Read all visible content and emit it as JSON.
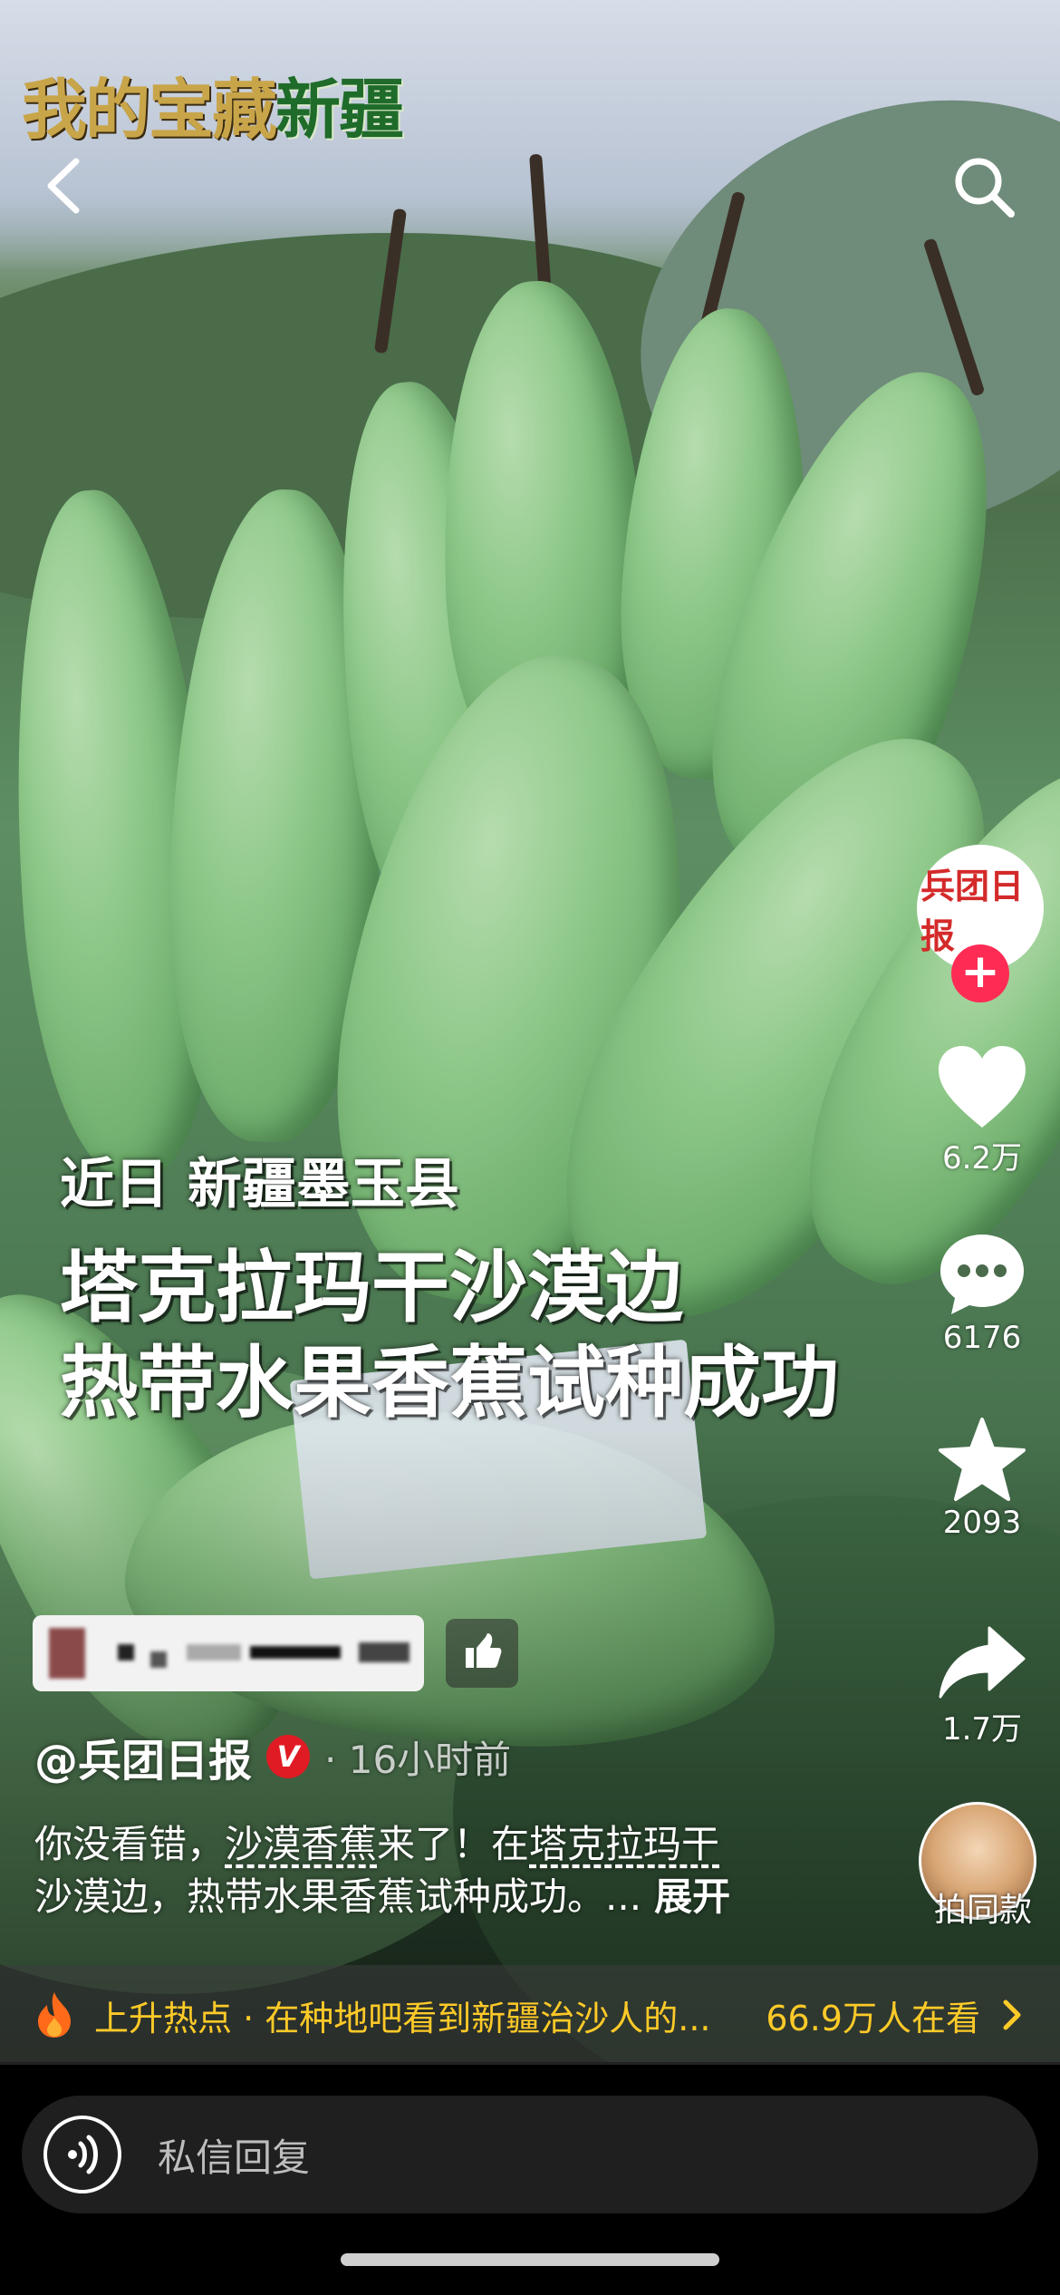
{
  "header": {
    "logo_part1": "我的宝藏",
    "logo_part2": "新疆",
    "back_icon": "chevron-left-icon",
    "search_icon": "search-icon"
  },
  "caption": {
    "line1": "近日 新疆墨玉县",
    "line2": "塔克拉玛干沙漠边",
    "line3": "热带水果香蕉试种成功"
  },
  "rail": {
    "avatar_text": "兵团日报",
    "follow_label": "+",
    "likes": "6.2万",
    "comments": "6176",
    "favorites": "2093",
    "shares": "1.7万",
    "same_label": "拍同款"
  },
  "post": {
    "author": "@兵团日报",
    "verified_badge": "V",
    "time": "· 16小时前",
    "desc_part1": "你没看错，",
    "desc_tag1": "沙漠香蕉",
    "desc_part2": "来了！在",
    "desc_tag2": "塔克拉玛干",
    "desc_part3": "沙漠边，热带水果香蕉试种成功。...",
    "expand_label": "展开"
  },
  "hot": {
    "text": "上升热点 · 在种地吧看到新疆治沙人的...",
    "count": "66.9万人在看",
    "accent": "#ffca28"
  },
  "composer": {
    "placeholder": "私信回复"
  },
  "colors": {
    "follow": "#fe2c55",
    "verified": "#e01b24"
  }
}
